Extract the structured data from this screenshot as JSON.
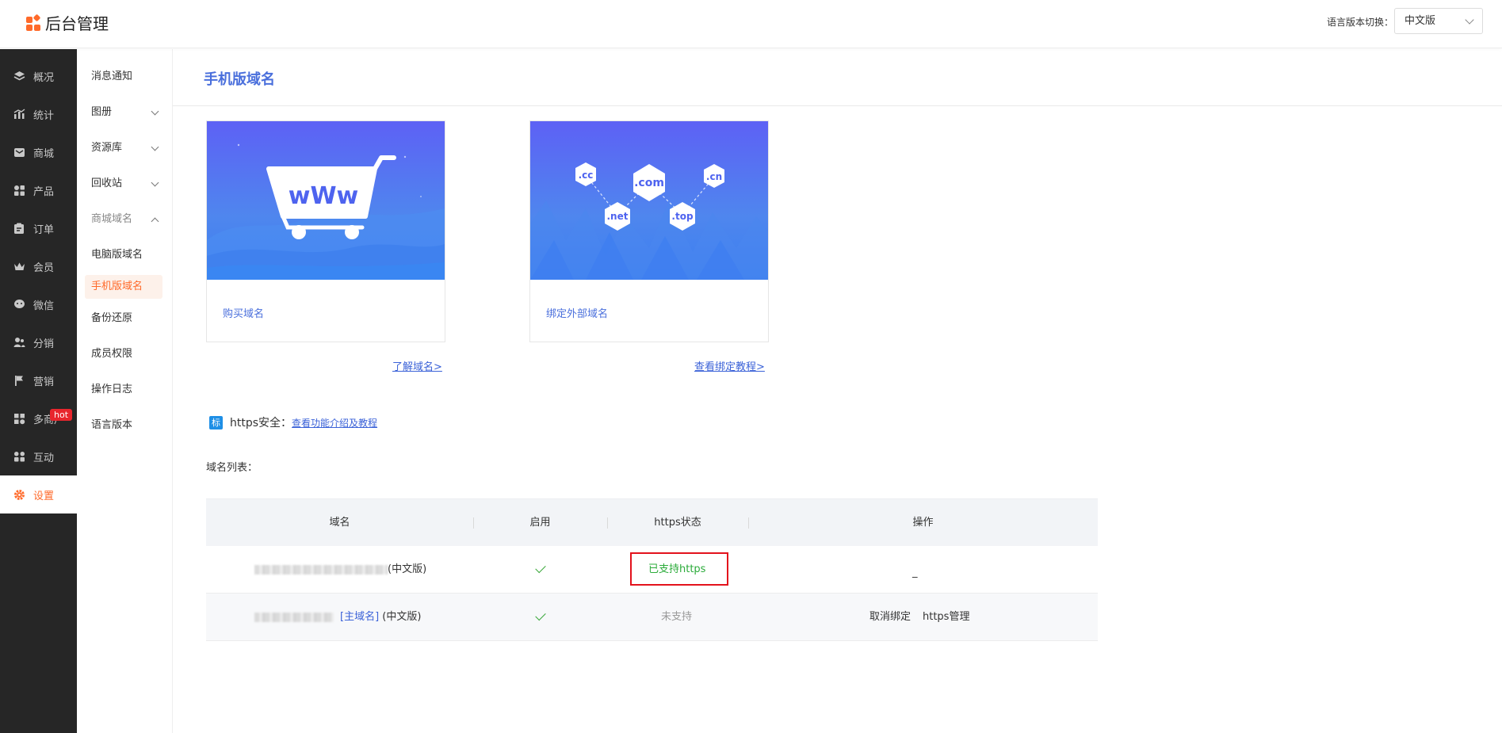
{
  "header": {
    "app_title": "后台管理",
    "lang_label": "语言版本切换：",
    "lang_value": "中文版"
  },
  "sidebar": {
    "items": [
      {
        "label": "概况",
        "icon": "layers-icon"
      },
      {
        "label": "统计",
        "icon": "chart-icon"
      },
      {
        "label": "商城",
        "icon": "mail-icon"
      },
      {
        "label": "产品",
        "icon": "grid-icon"
      },
      {
        "label": "订单",
        "icon": "clipboard-icon"
      },
      {
        "label": "会员",
        "icon": "crown-icon"
      },
      {
        "label": "微信",
        "icon": "wechat-icon"
      },
      {
        "label": "分销",
        "icon": "users-icon"
      },
      {
        "label": "营销",
        "icon": "flag-icon"
      },
      {
        "label": "多商户",
        "icon": "store-icon"
      },
      {
        "label": "互动",
        "icon": "people-icon"
      },
      {
        "label": "设置",
        "icon": "gear-icon"
      }
    ],
    "hot_badge": "hot"
  },
  "subnav": {
    "items": [
      {
        "label": "消息通知"
      },
      {
        "label": "图册"
      },
      {
        "label": "资源库"
      },
      {
        "label": "回收站"
      },
      {
        "label": "商城域名"
      },
      {
        "label": "电脑版域名"
      },
      {
        "label": "手机版域名"
      },
      {
        "label": "备份还原"
      },
      {
        "label": "成员权限"
      },
      {
        "label": "操作日志"
      },
      {
        "label": "语言版本"
      }
    ]
  },
  "main": {
    "page_title": "手机版域名",
    "cards": [
      {
        "label": "购买域名",
        "link": "了解域名>",
        "art_text": "wWw"
      },
      {
        "label": "绑定外部域名",
        "link": "查看绑定教程>",
        "tlds": [
          ".cc",
          ".com",
          ".cn",
          ".net",
          ".top"
        ]
      }
    ],
    "https": {
      "tag": "标",
      "label": "https安全：",
      "link": "查看功能介绍及教程"
    },
    "list_title": "域名列表：",
    "table": {
      "headers": [
        "域名",
        "启用",
        "https状态",
        "操作"
      ],
      "rows": [
        {
          "suffix": "(中文版)",
          "main_tag": "",
          "https_status": "已支持https",
          "action": "_",
          "actions": []
        },
        {
          "suffix": "(中文版)",
          "main_tag": "[主域名]",
          "https_status": "未支持",
          "action": "",
          "actions": [
            "取消绑定",
            "https管理"
          ]
        }
      ]
    }
  },
  "colors": {
    "accent": "#ff6a2a",
    "link": "#3b62d8",
    "sidebar_bg": "#262626",
    "ok": "#2bab3a",
    "highlight": "#e3121c"
  }
}
